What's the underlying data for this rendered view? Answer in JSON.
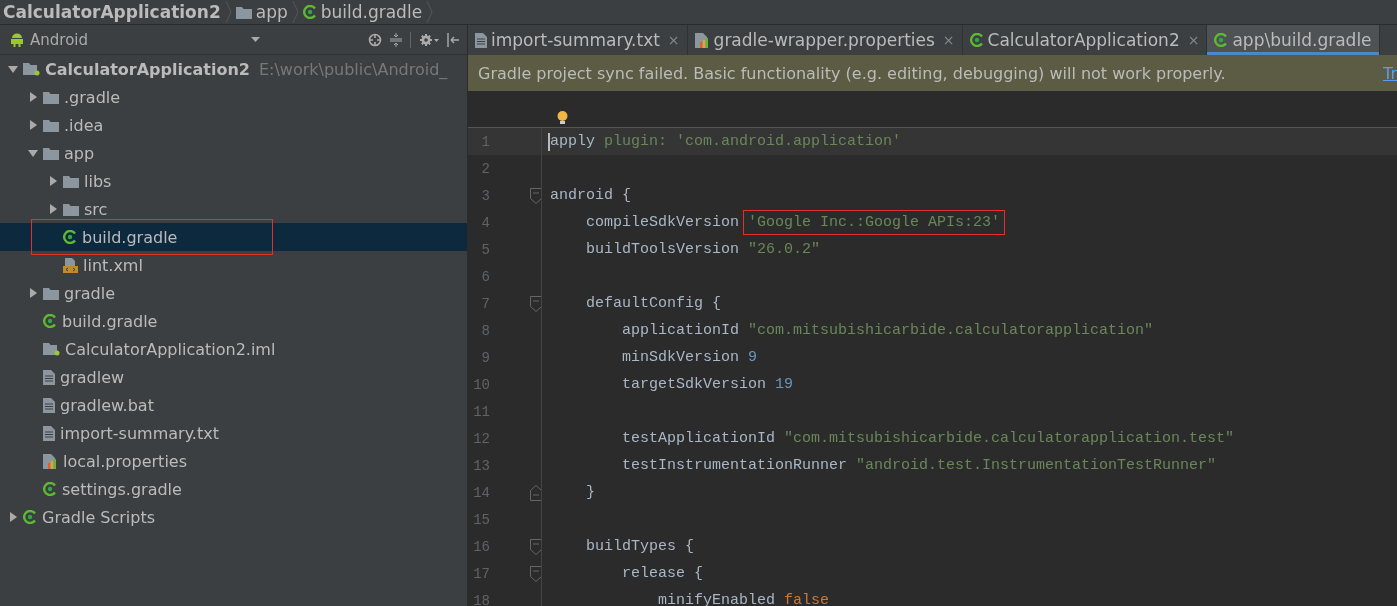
{
  "breadcrumb": [
    {
      "label": "CalculatorApplication2",
      "kind": "project"
    },
    {
      "label": "app",
      "kind": "folder"
    },
    {
      "label": "build.gradle",
      "kind": "gradle"
    }
  ],
  "project_panel": {
    "view": "Android",
    "tree": [
      {
        "label": "CalculatorApplication2",
        "location": "E:\\work\\public\\Android_",
        "kind": "module",
        "expanded": true,
        "selected": false,
        "annotated": false,
        "children": [
          {
            "label": ".gradle",
            "kind": "folder",
            "expanded": false,
            "selected": false,
            "annotated": false
          },
          {
            "label": ".idea",
            "kind": "folder",
            "expanded": false,
            "selected": false,
            "annotated": false
          },
          {
            "label": "app",
            "kind": "folder",
            "expanded": true,
            "selected": false,
            "annotated": false,
            "children": [
              {
                "label": "libs",
                "kind": "folder",
                "expanded": false,
                "selected": false,
                "annotated": false
              },
              {
                "label": "src",
                "kind": "folder",
                "expanded": false,
                "selected": false,
                "annotated": false
              },
              {
                "label": "build.gradle",
                "kind": "gradle",
                "selected": true,
                "annotated": true
              },
              {
                "label": "lint.xml",
                "kind": "xml",
                "selected": false,
                "annotated": false
              }
            ]
          },
          {
            "label": "gradle",
            "kind": "folder",
            "expanded": false,
            "selected": false,
            "annotated": false
          },
          {
            "label": "build.gradle",
            "kind": "gradle",
            "selected": false,
            "annotated": false
          },
          {
            "label": "CalculatorApplication2.iml",
            "kind": "module",
            "selected": false,
            "annotated": false
          },
          {
            "label": "gradlew",
            "kind": "text",
            "selected": false,
            "annotated": false
          },
          {
            "label": "gradlew.bat",
            "kind": "text",
            "selected": false,
            "annotated": false
          },
          {
            "label": "import-summary.txt",
            "kind": "text",
            "selected": false,
            "annotated": false
          },
          {
            "label": "local.properties",
            "kind": "properties",
            "selected": false,
            "annotated": false
          },
          {
            "label": "settings.gradle",
            "kind": "gradle",
            "selected": false,
            "annotated": false
          }
        ]
      },
      {
        "label": "Gradle Scripts",
        "kind": "gradle",
        "expanded": false,
        "selected": false,
        "annotated": false
      }
    ]
  },
  "tabs": [
    {
      "label": "import-summary.txt",
      "kind": "text",
      "selected": false,
      "close": "×"
    },
    {
      "label": "gradle-wrapper.properties",
      "kind": "properties",
      "selected": false,
      "close": "×"
    },
    {
      "label": "CalculatorApplication2",
      "kind": "gradle",
      "selected": false,
      "close": "×"
    },
    {
      "label": "app\\build.gradle",
      "kind": "gradle",
      "selected": true
    }
  ],
  "banner": {
    "message": "Gradle project sync failed. Basic functionality (e.g. editing, debugging) will not work properly.",
    "link": "Tr"
  },
  "code": [
    {
      "number": "1",
      "current": true,
      "kind": "plain",
      "tokens": [
        {
          "t": "apply ",
          "kind": "plain"
        },
        {
          "t": "plugin: ",
          "kind": "named"
        },
        {
          "t": "'com.android.application'",
          "kind": "string"
        }
      ]
    },
    {
      "number": "2",
      "current": false,
      "kind": "plain"
    },
    {
      "number": "3",
      "current": false,
      "kind": "fold_start",
      "tokens": [
        {
          "t": "android {",
          "kind": "plain"
        }
      ]
    },
    {
      "number": "4",
      "current": false,
      "kind": "plain",
      "tokens": [
        {
          "t": "    compileSdkVersion ",
          "kind": "plain"
        },
        {
          "t": "'Google Inc.:Google APIs:23'",
          "kind": "string",
          "annotated": true
        }
      ]
    },
    {
      "number": "5",
      "current": false,
      "kind": "plain",
      "tokens": [
        {
          "t": "    buildToolsVersion ",
          "kind": "plain"
        },
        {
          "t": "\"26.0.2\"",
          "kind": "string"
        }
      ]
    },
    {
      "number": "6",
      "current": false,
      "kind": "plain"
    },
    {
      "number": "7",
      "current": false,
      "kind": "fold_start",
      "tokens": [
        {
          "t": "    defaultConfig {",
          "kind": "plain"
        }
      ]
    },
    {
      "number": "8",
      "current": false,
      "kind": "plain",
      "tokens": [
        {
          "t": "        applicationId ",
          "kind": "plain"
        },
        {
          "t": "\"com.mitsubishicarbide.calculatorapplication\"",
          "kind": "string"
        }
      ]
    },
    {
      "number": "9",
      "current": false,
      "kind": "plain",
      "tokens": [
        {
          "t": "        minSdkVersion ",
          "kind": "plain"
        },
        {
          "t": "9",
          "kind": "number"
        }
      ]
    },
    {
      "number": "10",
      "current": false,
      "kind": "plain",
      "tokens": [
        {
          "t": "        targetSdkVersion ",
          "kind": "plain"
        },
        {
          "t": "19",
          "kind": "number"
        }
      ]
    },
    {
      "number": "11",
      "current": false,
      "kind": "plain"
    },
    {
      "number": "12",
      "current": false,
      "kind": "plain",
      "tokens": [
        {
          "t": "        testApplicationId ",
          "kind": "plain"
        },
        {
          "t": "\"com.mitsubishicarbide.calculatorapplication.test\"",
          "kind": "string"
        }
      ]
    },
    {
      "number": "13",
      "current": false,
      "kind": "plain",
      "tokens": [
        {
          "t": "        testInstrumentationRunner ",
          "kind": "plain"
        },
        {
          "t": "\"android.test.InstrumentationTestRunner\"",
          "kind": "string"
        }
      ]
    },
    {
      "number": "14",
      "current": false,
      "kind": "fold_end",
      "tokens": [
        {
          "t": "    }",
          "kind": "plain"
        }
      ]
    },
    {
      "number": "15",
      "current": false,
      "kind": "plain"
    },
    {
      "number": "16",
      "current": false,
      "kind": "fold_start",
      "tokens": [
        {
          "t": "    buildTypes {",
          "kind": "plain"
        }
      ]
    },
    {
      "number": "17",
      "current": false,
      "kind": "fold_start",
      "tokens": [
        {
          "t": "        release {",
          "kind": "plain"
        }
      ]
    },
    {
      "number": "18",
      "current": false,
      "kind": "plain",
      "tokens": [
        {
          "t": "            minifyEnabled ",
          "kind": "plain"
        },
        {
          "t": "false",
          "kind": "keyword"
        }
      ]
    }
  ]
}
